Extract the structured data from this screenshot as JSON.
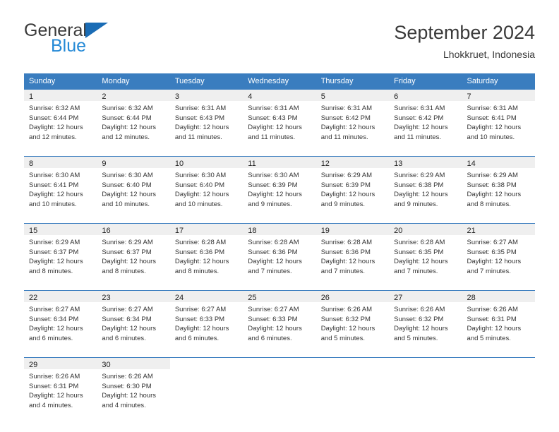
{
  "logo": {
    "word1": "General",
    "word2": "Blue",
    "triangle_color": "#1a6cb5",
    "blue_color": "#2489d6"
  },
  "header": {
    "title": "September 2024",
    "subtitle": "Lhokkruet, Indonesia"
  },
  "theme": {
    "header_bg": "#3a7dbf",
    "header_text": "#ffffff",
    "daynum_bg": "#efefef",
    "body_text": "#333333"
  },
  "weekdays": [
    "Sunday",
    "Monday",
    "Tuesday",
    "Wednesday",
    "Thursday",
    "Friday",
    "Saturday"
  ],
  "weeks": [
    [
      {
        "day": "1",
        "sunrise": "Sunrise: 6:32 AM",
        "sunset": "Sunset: 6:44 PM",
        "daylight1": "Daylight: 12 hours",
        "daylight2": "and 12 minutes."
      },
      {
        "day": "2",
        "sunrise": "Sunrise: 6:32 AM",
        "sunset": "Sunset: 6:44 PM",
        "daylight1": "Daylight: 12 hours",
        "daylight2": "and 12 minutes."
      },
      {
        "day": "3",
        "sunrise": "Sunrise: 6:31 AM",
        "sunset": "Sunset: 6:43 PM",
        "daylight1": "Daylight: 12 hours",
        "daylight2": "and 11 minutes."
      },
      {
        "day": "4",
        "sunrise": "Sunrise: 6:31 AM",
        "sunset": "Sunset: 6:43 PM",
        "daylight1": "Daylight: 12 hours",
        "daylight2": "and 11 minutes."
      },
      {
        "day": "5",
        "sunrise": "Sunrise: 6:31 AM",
        "sunset": "Sunset: 6:42 PM",
        "daylight1": "Daylight: 12 hours",
        "daylight2": "and 11 minutes."
      },
      {
        "day": "6",
        "sunrise": "Sunrise: 6:31 AM",
        "sunset": "Sunset: 6:42 PM",
        "daylight1": "Daylight: 12 hours",
        "daylight2": "and 11 minutes."
      },
      {
        "day": "7",
        "sunrise": "Sunrise: 6:31 AM",
        "sunset": "Sunset: 6:41 PM",
        "daylight1": "Daylight: 12 hours",
        "daylight2": "and 10 minutes."
      }
    ],
    [
      {
        "day": "8",
        "sunrise": "Sunrise: 6:30 AM",
        "sunset": "Sunset: 6:41 PM",
        "daylight1": "Daylight: 12 hours",
        "daylight2": "and 10 minutes."
      },
      {
        "day": "9",
        "sunrise": "Sunrise: 6:30 AM",
        "sunset": "Sunset: 6:40 PM",
        "daylight1": "Daylight: 12 hours",
        "daylight2": "and 10 minutes."
      },
      {
        "day": "10",
        "sunrise": "Sunrise: 6:30 AM",
        "sunset": "Sunset: 6:40 PM",
        "daylight1": "Daylight: 12 hours",
        "daylight2": "and 10 minutes."
      },
      {
        "day": "11",
        "sunrise": "Sunrise: 6:30 AM",
        "sunset": "Sunset: 6:39 PM",
        "daylight1": "Daylight: 12 hours",
        "daylight2": "and 9 minutes."
      },
      {
        "day": "12",
        "sunrise": "Sunrise: 6:29 AM",
        "sunset": "Sunset: 6:39 PM",
        "daylight1": "Daylight: 12 hours",
        "daylight2": "and 9 minutes."
      },
      {
        "day": "13",
        "sunrise": "Sunrise: 6:29 AM",
        "sunset": "Sunset: 6:38 PM",
        "daylight1": "Daylight: 12 hours",
        "daylight2": "and 9 minutes."
      },
      {
        "day": "14",
        "sunrise": "Sunrise: 6:29 AM",
        "sunset": "Sunset: 6:38 PM",
        "daylight1": "Daylight: 12 hours",
        "daylight2": "and 8 minutes."
      }
    ],
    [
      {
        "day": "15",
        "sunrise": "Sunrise: 6:29 AM",
        "sunset": "Sunset: 6:37 PM",
        "daylight1": "Daylight: 12 hours",
        "daylight2": "and 8 minutes."
      },
      {
        "day": "16",
        "sunrise": "Sunrise: 6:29 AM",
        "sunset": "Sunset: 6:37 PM",
        "daylight1": "Daylight: 12 hours",
        "daylight2": "and 8 minutes."
      },
      {
        "day": "17",
        "sunrise": "Sunrise: 6:28 AM",
        "sunset": "Sunset: 6:36 PM",
        "daylight1": "Daylight: 12 hours",
        "daylight2": "and 8 minutes."
      },
      {
        "day": "18",
        "sunrise": "Sunrise: 6:28 AM",
        "sunset": "Sunset: 6:36 PM",
        "daylight1": "Daylight: 12 hours",
        "daylight2": "and 7 minutes."
      },
      {
        "day": "19",
        "sunrise": "Sunrise: 6:28 AM",
        "sunset": "Sunset: 6:36 PM",
        "daylight1": "Daylight: 12 hours",
        "daylight2": "and 7 minutes."
      },
      {
        "day": "20",
        "sunrise": "Sunrise: 6:28 AM",
        "sunset": "Sunset: 6:35 PM",
        "daylight1": "Daylight: 12 hours",
        "daylight2": "and 7 minutes."
      },
      {
        "day": "21",
        "sunrise": "Sunrise: 6:27 AM",
        "sunset": "Sunset: 6:35 PM",
        "daylight1": "Daylight: 12 hours",
        "daylight2": "and 7 minutes."
      }
    ],
    [
      {
        "day": "22",
        "sunrise": "Sunrise: 6:27 AM",
        "sunset": "Sunset: 6:34 PM",
        "daylight1": "Daylight: 12 hours",
        "daylight2": "and 6 minutes."
      },
      {
        "day": "23",
        "sunrise": "Sunrise: 6:27 AM",
        "sunset": "Sunset: 6:34 PM",
        "daylight1": "Daylight: 12 hours",
        "daylight2": "and 6 minutes."
      },
      {
        "day": "24",
        "sunrise": "Sunrise: 6:27 AM",
        "sunset": "Sunset: 6:33 PM",
        "daylight1": "Daylight: 12 hours",
        "daylight2": "and 6 minutes."
      },
      {
        "day": "25",
        "sunrise": "Sunrise: 6:27 AM",
        "sunset": "Sunset: 6:33 PM",
        "daylight1": "Daylight: 12 hours",
        "daylight2": "and 6 minutes."
      },
      {
        "day": "26",
        "sunrise": "Sunrise: 6:26 AM",
        "sunset": "Sunset: 6:32 PM",
        "daylight1": "Daylight: 12 hours",
        "daylight2": "and 5 minutes."
      },
      {
        "day": "27",
        "sunrise": "Sunrise: 6:26 AM",
        "sunset": "Sunset: 6:32 PM",
        "daylight1": "Daylight: 12 hours",
        "daylight2": "and 5 minutes."
      },
      {
        "day": "28",
        "sunrise": "Sunrise: 6:26 AM",
        "sunset": "Sunset: 6:31 PM",
        "daylight1": "Daylight: 12 hours",
        "daylight2": "and 5 minutes."
      }
    ],
    [
      {
        "day": "29",
        "sunrise": "Sunrise: 6:26 AM",
        "sunset": "Sunset: 6:31 PM",
        "daylight1": "Daylight: 12 hours",
        "daylight2": "and 4 minutes."
      },
      {
        "day": "30",
        "sunrise": "Sunrise: 6:26 AM",
        "sunset": "Sunset: 6:30 PM",
        "daylight1": "Daylight: 12 hours",
        "daylight2": "and 4 minutes."
      },
      {
        "day": "",
        "sunrise": "",
        "sunset": "",
        "daylight1": "",
        "daylight2": ""
      },
      {
        "day": "",
        "sunrise": "",
        "sunset": "",
        "daylight1": "",
        "daylight2": ""
      },
      {
        "day": "",
        "sunrise": "",
        "sunset": "",
        "daylight1": "",
        "daylight2": ""
      },
      {
        "day": "",
        "sunrise": "",
        "sunset": "",
        "daylight1": "",
        "daylight2": ""
      },
      {
        "day": "",
        "sunrise": "",
        "sunset": "",
        "daylight1": "",
        "daylight2": ""
      }
    ]
  ]
}
